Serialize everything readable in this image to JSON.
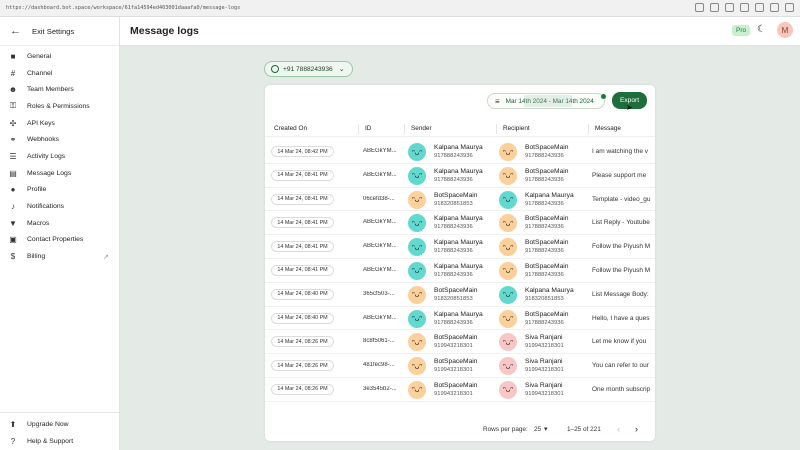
{
  "browser": {
    "url": "https://dashboard.bot.space/workspace/61fa14594ed403001daaafa0/message-logs"
  },
  "sidebar": {
    "back_label": "Exit Settings",
    "items": [
      {
        "label": "General",
        "icon": "briefcase-icon"
      },
      {
        "label": "Channel",
        "icon": "hash-icon"
      },
      {
        "label": "Team Members",
        "icon": "people-icon"
      },
      {
        "label": "Roles & Permissions",
        "icon": "lock-person-icon"
      },
      {
        "label": "API Keys",
        "icon": "api-icon"
      },
      {
        "label": "Webhooks",
        "icon": "webhook-icon"
      },
      {
        "label": "Activity Logs",
        "icon": "list-icon"
      },
      {
        "label": "Message Logs",
        "icon": "message-log-icon"
      },
      {
        "label": "Profile",
        "icon": "profile-icon"
      },
      {
        "label": "Notifications",
        "icon": "bell-icon"
      },
      {
        "label": "Macros",
        "icon": "bookmark-icon"
      },
      {
        "label": "Contact Properties",
        "icon": "contact-card-icon"
      },
      {
        "label": "Billing",
        "icon": "dollar-icon"
      }
    ],
    "bottom_items": [
      {
        "label": "Upgrade Now",
        "icon": "upgrade-icon"
      },
      {
        "label": "Help & Support",
        "icon": "help-icon"
      }
    ]
  },
  "header": {
    "title": "Message logs",
    "pro_badge": "Pro",
    "avatar_initial": "M"
  },
  "filters": {
    "phone": "+91 7888243936",
    "date_range": "Mar 14th 2024 - Mar 14th 2024",
    "export_label": "Export"
  },
  "table": {
    "columns": {
      "created_on": "Created On",
      "id": "ID",
      "sender": "Sender",
      "recipient": "Recipient",
      "message": "Message"
    },
    "rows": [
      {
        "created": "14 Mar 24, 08:42 PM",
        "id": "ABEGkYM...",
        "sender_name": "Kalpana Maurya",
        "sender_num": "917888243936",
        "sender_face": "teal",
        "recip_name": "BotSpaceMain",
        "recip_num": "917888243936",
        "recip_face": "orange",
        "message": "I am watching the v"
      },
      {
        "created": "14 Mar 24, 08:41 PM",
        "id": "ABEGkYM...",
        "sender_name": "Kalpana Maurya",
        "sender_num": "917888243936",
        "sender_face": "teal",
        "recip_name": "BotSpaceMain",
        "recip_num": "917888243936",
        "recip_face": "orange",
        "message": "Please support me"
      },
      {
        "created": "14 Mar 24, 08:41 PM",
        "id": "06cefd38-...",
        "sender_name": "BotSpaceMain",
        "sender_num": "918320851853",
        "sender_face": "orange",
        "recip_name": "Kalpana Maurya",
        "recip_num": "917888243936",
        "recip_face": "teal",
        "message": "Template - video_gu"
      },
      {
        "created": "14 Mar 24, 08:41 PM",
        "id": "ABEGkYM...",
        "sender_name": "Kalpana Maurya",
        "sender_num": "917888243936",
        "sender_face": "teal",
        "recip_name": "BotSpaceMain",
        "recip_num": "917888243936",
        "recip_face": "orange",
        "message": "List Reply - Youtube"
      },
      {
        "created": "14 Mar 24, 08:41 PM",
        "id": "ABEGkYM...",
        "sender_name": "Kalpana Maurya",
        "sender_num": "917888243936",
        "sender_face": "teal",
        "recip_name": "BotSpaceMain",
        "recip_num": "917888243936",
        "recip_face": "orange",
        "message": "Follow the Piyush M"
      },
      {
        "created": "14 Mar 24, 08:41 PM",
        "id": "ABEGkYM...",
        "sender_name": "Kalpana Maurya",
        "sender_num": "917888243936",
        "sender_face": "teal",
        "recip_name": "BotSpaceMain",
        "recip_num": "917888243936",
        "recip_face": "orange",
        "message": "Follow the Piyush M"
      },
      {
        "created": "14 Mar 24, 08:40 PM",
        "id": "365cf503-...",
        "sender_name": "BotSpaceMain",
        "sender_num": "918320851853",
        "sender_face": "orange",
        "recip_name": "Kalpana Maurya",
        "recip_num": "918320851853",
        "recip_face": "teal",
        "message": "List Message Body:"
      },
      {
        "created": "14 Mar 24, 08:40 PM",
        "id": "ABEGkYM...",
        "sender_name": "Kalpana Maurya",
        "sender_num": "917888243936",
        "sender_face": "teal",
        "recip_name": "BotSpaceMain",
        "recip_num": "917888243936",
        "recip_face": "orange",
        "message": "Hello, I have a ques"
      },
      {
        "created": "14 Mar 24, 08:26 PM",
        "id": "8c8f5061-...",
        "sender_name": "BotSpaceMain",
        "sender_num": "919943218301",
        "sender_face": "orange",
        "recip_name": "Siva Ranjani",
        "recip_num": "919943218301",
        "recip_face": "pink",
        "message": "Let me know if you"
      },
      {
        "created": "14 Mar 24, 08:26 PM",
        "id": "481fec98-...",
        "sender_name": "BotSpaceMain",
        "sender_num": "919943218301",
        "sender_face": "orange",
        "recip_name": "Siva Ranjani",
        "recip_num": "919943218301",
        "recip_face": "pink",
        "message": "You can refer to our"
      },
      {
        "created": "14 Mar 24, 08:26 PM",
        "id": "3e3545b2-...",
        "sender_name": "BotSpaceMain",
        "sender_num": "919943218301",
        "sender_face": "orange",
        "recip_name": "Siva Ranjani",
        "recip_num": "919943218301",
        "recip_face": "pink",
        "message": "One month subscrip"
      }
    ]
  },
  "pagination": {
    "rows_per_page_label": "Rows per page:",
    "rows_per_page": "25",
    "range": "1–25 of 221"
  },
  "colors": {
    "accent": "#1d6e3a",
    "background": "#e4ebe6"
  }
}
